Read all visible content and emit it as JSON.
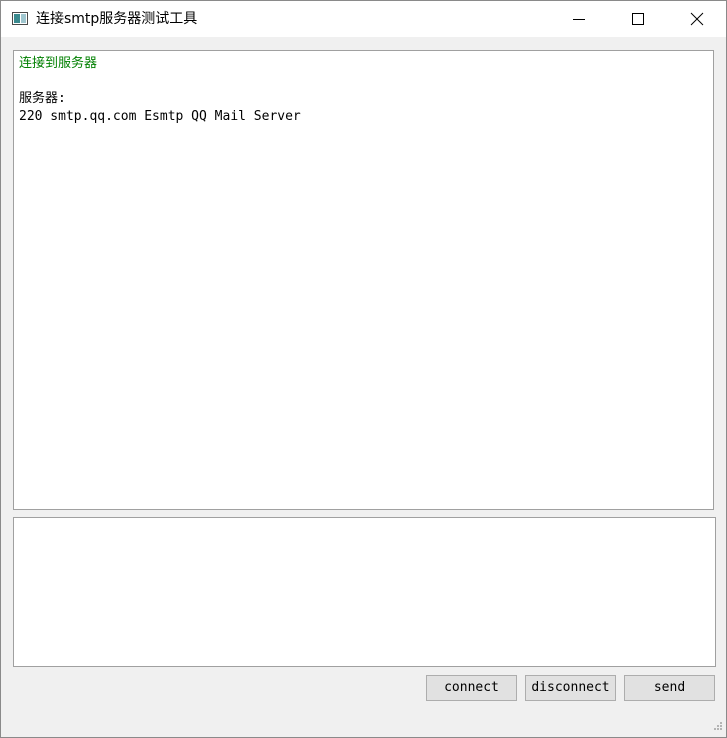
{
  "window": {
    "title": "连接smtp服务器测试工具",
    "icon": "app-window-icon",
    "controls": [
      "minimize-icon",
      "maximize-icon",
      "close-icon"
    ]
  },
  "output": {
    "lines": [
      {
        "text": "连接到服务器",
        "color": "#008000"
      },
      {
        "text": ""
      },
      {
        "text": "服务器:"
      },
      {
        "text": "220 smtp.qq.com Esmtp QQ Mail Server"
      }
    ]
  },
  "input": {
    "value": "",
    "placeholder": ""
  },
  "buttons": {
    "connect": "connect",
    "disconnect": "disconnect",
    "send": "send"
  },
  "colors": {
    "status_text": "#008000",
    "background": "#f0f0f0"
  }
}
